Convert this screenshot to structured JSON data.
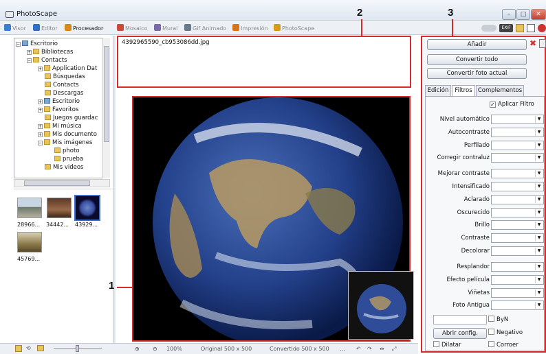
{
  "window": {
    "title": "PhotoScape"
  },
  "tabs": [
    {
      "label": "Visor",
      "color": "#3a7dd1"
    },
    {
      "label": "Editor",
      "color": "#2f6fc4"
    },
    {
      "label": "Procesador",
      "color": "#d68a1a"
    },
    {
      "label": "Mosaico",
      "color": "#c94a3a"
    },
    {
      "label": "Mural",
      "color": "#7a6aa8"
    },
    {
      "label": "Gif Animado",
      "color": "#6a7a8a"
    },
    {
      "label": "Impresión",
      "color": "#d6751a"
    },
    {
      "label": "PhotoScape",
      "color": "#d69a1a"
    }
  ],
  "tree": [
    {
      "label": "Escritorio"
    },
    {
      "label": "Bibliotecas"
    },
    {
      "label": "Contacts"
    },
    {
      "label": "Application Dat"
    },
    {
      "label": "Búsquedas"
    },
    {
      "label": "Contacts"
    },
    {
      "label": "Descargas"
    },
    {
      "label": "Escritorio"
    },
    {
      "label": "Favoritos"
    },
    {
      "label": "Juegos guardac"
    },
    {
      "label": "Mi música"
    },
    {
      "label": "Mis documento"
    },
    {
      "label": "Mis imágenes"
    },
    {
      "label": "photo"
    },
    {
      "label": "prueba"
    },
    {
      "label": "Mis videos"
    }
  ],
  "thumbnails": [
    {
      "label": "28966..."
    },
    {
      "label": "34442..."
    },
    {
      "label": "43929..."
    },
    {
      "label": "45769..."
    }
  ],
  "filelist": {
    "file": "4392965590_cb953086dd.jpg"
  },
  "status": {
    "zoom": "100%",
    "original": "Original 500 x 500",
    "converted": "Convertido 500 x 500"
  },
  "panel": {
    "add": "Añadir",
    "convert_all": "Convertir todo",
    "convert_current": "Convertir foto actual",
    "tabs": [
      "Edición",
      "Filtros",
      "Complementos"
    ],
    "apply_filter": "Aplicar Filtro",
    "filters": [
      "Nivel automático",
      "Autocontraste",
      "Perfilado",
      "Corregir contraluz",
      "Mejorar contraste",
      "Intensificado",
      "Aclarado",
      "Oscurecido",
      "Brillo",
      "Contraste",
      "Decolorar",
      "Resplandor",
      "Efecto película",
      "Viñetas",
      "Foto Antigua"
    ],
    "byn": "ByN",
    "open_config": "Abrir config.",
    "negativo": "Negativo",
    "dilatar": "Dilatar",
    "corroer": "Corroer"
  },
  "annotations": {
    "one": "1",
    "two": "2",
    "three": "3"
  },
  "accent_red": "#d62b2b"
}
